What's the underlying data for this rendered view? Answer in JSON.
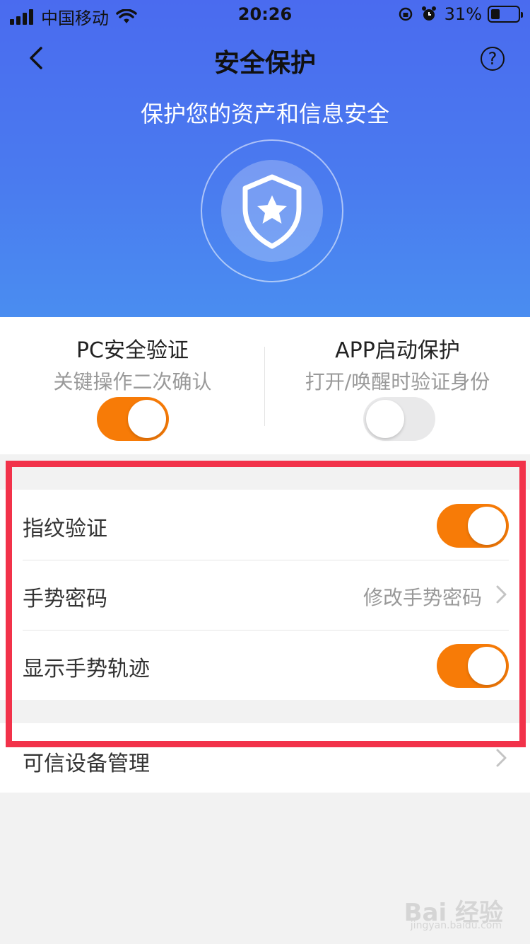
{
  "status_bar": {
    "carrier": "中国移动",
    "time": "20:26",
    "battery": "31%"
  },
  "nav": {
    "title": "安全保护",
    "help": "?"
  },
  "hero": {
    "subtitle": "保护您的资产和信息安全"
  },
  "quick": [
    {
      "title": "PC安全验证",
      "subtitle": "关键操作二次确认",
      "enabled": true
    },
    {
      "title": "APP启动保护",
      "subtitle": "打开/唤醒时验证身份",
      "enabled": false
    }
  ],
  "settings": [
    {
      "label": "指纹验证",
      "type": "toggle",
      "enabled": true
    },
    {
      "label": "手势密码",
      "type": "link",
      "value": "修改手势密码"
    },
    {
      "label": "显示手势轨迹",
      "type": "toggle",
      "enabled": true
    }
  ],
  "devices": {
    "label": "可信设备管理"
  },
  "watermark": {
    "brand": "Bai 经验",
    "url": "jingyan.baidu.com"
  },
  "colors": {
    "accent_orange": "#f77b07",
    "hero_blue": "#4a6bef",
    "highlight_red": "#f2324a"
  }
}
